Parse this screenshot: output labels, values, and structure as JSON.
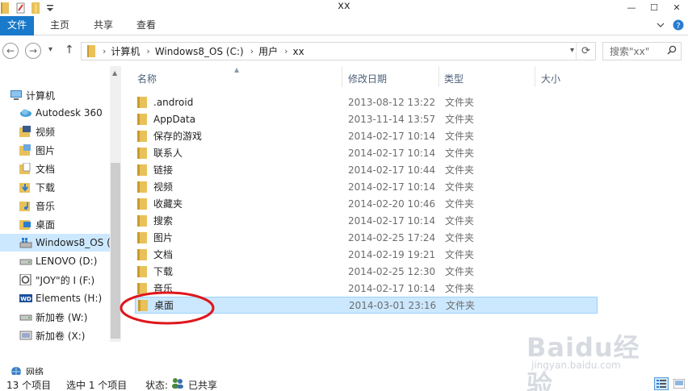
{
  "window": {
    "title": "xx",
    "controls": {
      "minimize": "—",
      "maximize": "☐",
      "close": "✕"
    }
  },
  "ribbon": {
    "tabs": [
      {
        "label": "文件",
        "active": true
      },
      {
        "label": "主页"
      },
      {
        "label": "共享"
      },
      {
        "label": "查看"
      }
    ],
    "expand_icon": "chevron-down-icon",
    "help_icon": "help-icon"
  },
  "address_bar": {
    "breadcrumb": [
      "计算机",
      "Windows8_OS (C:)",
      "用户",
      "xx"
    ],
    "separator": "›",
    "dropdown": "▾",
    "refresh": "⟳"
  },
  "search": {
    "placeholder": "搜索\"xx\"",
    "icon": "search-icon"
  },
  "nav": {
    "back": "←",
    "forward": "→",
    "recent": "▾",
    "up": "↑"
  },
  "sidebar": {
    "items": [
      {
        "label": "计算机",
        "icon": "computer-icon"
      },
      {
        "label": "Autodesk 360",
        "icon": "cloud-icon"
      },
      {
        "label": "视频",
        "icon": "video-folder-icon"
      },
      {
        "label": "图片",
        "icon": "pictures-folder-icon"
      },
      {
        "label": "文档",
        "icon": "documents-folder-icon"
      },
      {
        "label": "下载",
        "icon": "downloads-folder-icon"
      },
      {
        "label": "音乐",
        "icon": "music-folder-icon"
      },
      {
        "label": "桌面",
        "icon": "desktop-folder-icon"
      },
      {
        "label": "Windows8_OS (",
        "icon": "system-drive-icon",
        "selected": true
      },
      {
        "label": "LENOVO (D:)",
        "icon": "drive-icon"
      },
      {
        "label": "\"JOY\"的 I (F:)",
        "icon": "optical-drive-icon"
      },
      {
        "label": "Elements (H:)",
        "icon": "wd-drive-icon"
      },
      {
        "label": "新加卷 (W:)",
        "icon": "drive-icon"
      },
      {
        "label": "新加卷 (X:)",
        "icon": "drive-icon"
      },
      {
        "label": "网络",
        "icon": "network-icon"
      }
    ]
  },
  "file_list": {
    "columns": [
      "名称",
      "修改日期",
      "类型",
      "大小"
    ],
    "rows": [
      {
        "name": ".android",
        "date": "2013-08-12 13:22",
        "type": "文件夹"
      },
      {
        "name": "AppData",
        "date": "2013-11-14 13:57",
        "type": "文件夹"
      },
      {
        "name": "保存的游戏",
        "date": "2014-02-17 10:14",
        "type": "文件夹"
      },
      {
        "name": "联系人",
        "date": "2014-02-17 10:14",
        "type": "文件夹"
      },
      {
        "name": "链接",
        "date": "2014-02-17 10:44",
        "type": "文件夹"
      },
      {
        "name": "视频",
        "date": "2014-02-17 10:14",
        "type": "文件夹"
      },
      {
        "name": "收藏夹",
        "date": "2014-02-20 10:46",
        "type": "文件夹"
      },
      {
        "name": "搜索",
        "date": "2014-02-17 10:14",
        "type": "文件夹"
      },
      {
        "name": "图片",
        "date": "2014-02-25 17:24",
        "type": "文件夹"
      },
      {
        "name": "文档",
        "date": "2014-02-19 19:21",
        "type": "文件夹"
      },
      {
        "name": "下载",
        "date": "2014-02-25 12:30",
        "type": "文件夹"
      },
      {
        "name": "音乐",
        "date": "2014-02-17 10:14",
        "type": "文件夹"
      },
      {
        "name": "桌面",
        "date": "2014-03-01 23:16",
        "type": "文件夹",
        "selected": true
      }
    ]
  },
  "status_bar": {
    "item_count": "13 个项目",
    "selection": "选中 1 个项目",
    "state_label": "状态:",
    "state_value": "已共享"
  },
  "colors": {
    "file_tab": "#1979ca",
    "selection_bg": "#cce8ff",
    "selection_border": "#99d1ff",
    "folder": "#e8c15a",
    "annotation": "#e0161b"
  },
  "watermark": {
    "logo": "Baidu经验",
    "url": "jingyan.baidu.com"
  }
}
